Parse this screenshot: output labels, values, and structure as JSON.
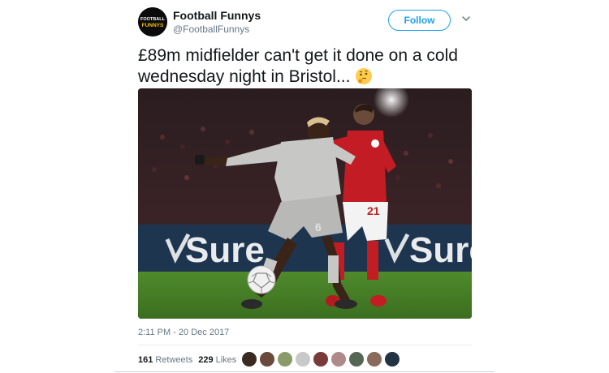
{
  "author": {
    "display_name": "Football Funnys",
    "handle": "@FootballFunnys",
    "avatar_text_top": "FOOTBALL",
    "avatar_text_bottom": "FUNNYS"
  },
  "follow_label": "Follow",
  "tweet_text": {
    "line1": "£89m midfielder can't get it done on a cold",
    "line2": "wednesday night in Bristol..."
  },
  "emoji": "thinking-face-icon",
  "media": {
    "sponsor_text": "Sure",
    "home_shirt_number": "21",
    "away_shirt_number": "6"
  },
  "timestamp": "2:11 PM - 20 Dec 2017",
  "stats": {
    "retweets_count": "161",
    "retweets_label": "Retweets",
    "likes_count": "229",
    "likes_label": "Likes"
  },
  "likers": [
    "#3b2a22",
    "#6a4a3a",
    "#8a9b6a",
    "#c9c9c9",
    "#7a3a3a",
    "#b08a8a",
    "#556655",
    "#8a6a5a",
    "#223344"
  ],
  "colors": {
    "accent": "#1da1f2",
    "text": "#14171a",
    "secondary": "#657786"
  }
}
